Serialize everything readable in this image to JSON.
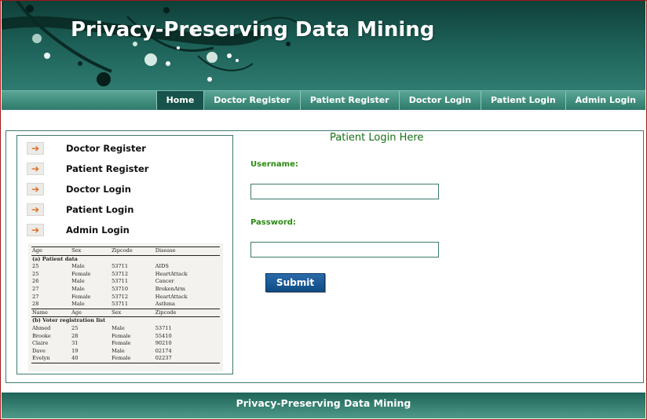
{
  "header": {
    "title": "Privacy-Preserving Data Mining"
  },
  "nav": {
    "items": [
      {
        "label": "Home",
        "active": true
      },
      {
        "label": "Doctor Register"
      },
      {
        "label": "Patient Register"
      },
      {
        "label": "Doctor Login"
      },
      {
        "label": "Patient Login"
      },
      {
        "label": "Admin Login"
      }
    ]
  },
  "sidebar": {
    "items": [
      {
        "label": "Doctor Register",
        "icon": "arrow-right-icon"
      },
      {
        "label": "Patient Register",
        "icon": "arrow-right-icon"
      },
      {
        "label": "Doctor Login",
        "icon": "arrow-right-icon"
      },
      {
        "label": "Patient Login",
        "icon": "arrow-right-icon"
      },
      {
        "label": "Admin Login",
        "icon": "arrow-right-icon"
      }
    ],
    "table": {
      "patient_headers": [
        "Age",
        "Sex",
        "Zipcode",
        "Disease"
      ],
      "patient_caption": "(a) Patient data",
      "patient_rows": [
        [
          "25",
          "Male",
          "53711",
          "AIDS"
        ],
        [
          "25",
          "Female",
          "53712",
          "HeartAttack"
        ],
        [
          "26",
          "Male",
          "53711",
          "Cancer"
        ],
        [
          "27",
          "Male",
          "53710",
          "BrokenArm"
        ],
        [
          "27",
          "Female",
          "53712",
          "HeartAttack"
        ],
        [
          "28",
          "Male",
          "53711",
          "Asthma"
        ]
      ],
      "voter_headers": [
        "Name",
        "Age",
        "Sex",
        "Zipcode"
      ],
      "voter_caption": "(b) Voter registration list",
      "voter_rows": [
        [
          "Ahmed",
          "25",
          "Male",
          "53711"
        ],
        [
          "Brooke",
          "28",
          "Female",
          "55410"
        ],
        [
          "Claire",
          "31",
          "Female",
          "90210"
        ],
        [
          "Dave",
          "19",
          "Male",
          "02174"
        ],
        [
          "Evelyn",
          "40",
          "Female",
          "02237"
        ]
      ]
    }
  },
  "form": {
    "title": "Patient Login Here",
    "username_label": "Username:",
    "username_value": "",
    "password_label": "Password:",
    "password_value": "",
    "submit_label": "Submit"
  },
  "footer": {
    "text": "Privacy-Preserving Data Mining"
  },
  "colors": {
    "brand_dark": "#0f3f38",
    "nav_active": "#17534a",
    "label_green": "#2a8a10",
    "button_blue": "#0e4d86",
    "arrow_orange": "#e06a1a"
  }
}
